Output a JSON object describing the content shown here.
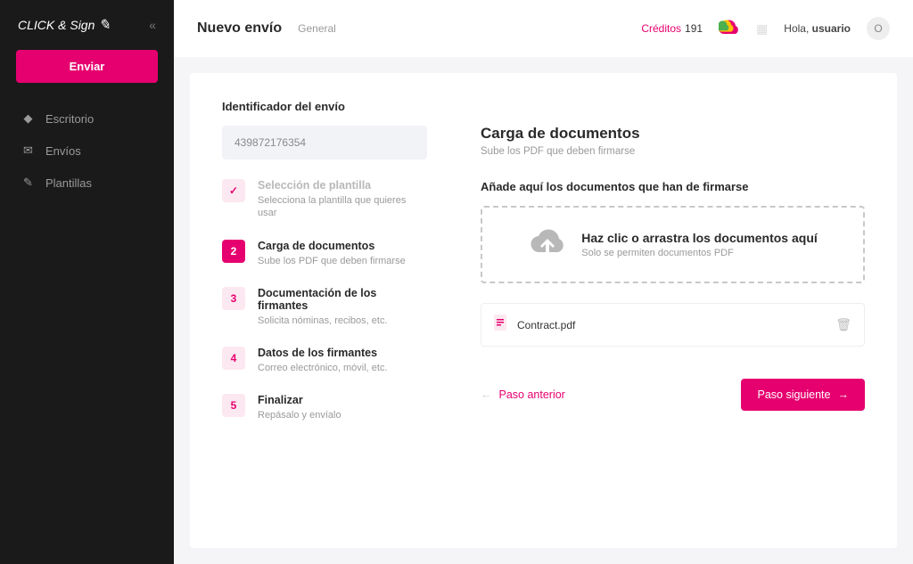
{
  "brand": "CLICK & Sign",
  "sidebar": {
    "send_label": "Enviar",
    "items": [
      {
        "icon": "◆",
        "label": "Escritorio"
      },
      {
        "icon": "✉",
        "label": "Envíos"
      },
      {
        "icon": "✎",
        "label": "Plantillas"
      }
    ]
  },
  "header": {
    "title": "Nuevo envío",
    "subtitle": "General",
    "credits_label": "Créditos",
    "credits_value": "191",
    "greeting_prefix": "Hola, ",
    "greeting_user": "usuario",
    "avatar_initial": "O"
  },
  "wizard": {
    "identifier_label": "Identificador del envío",
    "identifier_value": "439872176354",
    "steps": [
      {
        "marker": "✓",
        "title": "Selección de plantilla",
        "desc": "Selecciona la plantilla que quieres usar",
        "state": "done"
      },
      {
        "marker": "2",
        "title": "Carga de documentos",
        "desc": "Sube los PDF que deben firmarse",
        "state": "active"
      },
      {
        "marker": "3",
        "title": "Documentación de los firmantes",
        "desc": "Solicita nóminas, recibos, etc.",
        "state": "pending"
      },
      {
        "marker": "4",
        "title": "Datos de los firmantes",
        "desc": "Correo electrónico, móvil, etc.",
        "state": "pending"
      },
      {
        "marker": "5",
        "title": "Finalizar",
        "desc": "Repásalo y envíalo",
        "state": "pending"
      }
    ]
  },
  "panel": {
    "heading": "Carga de documentos",
    "subheading": "Sube los PDF que deben firmarse",
    "add_label": "Añade aquí los documentos que han de firmarse",
    "dropzone_title": "Haz clic o arrastra los documentos aquí",
    "dropzone_sub": "Solo se permiten documentos PDF",
    "file_name": "Contract.pdf",
    "prev_label": "Paso anterior",
    "next_label": "Paso siguiente"
  }
}
